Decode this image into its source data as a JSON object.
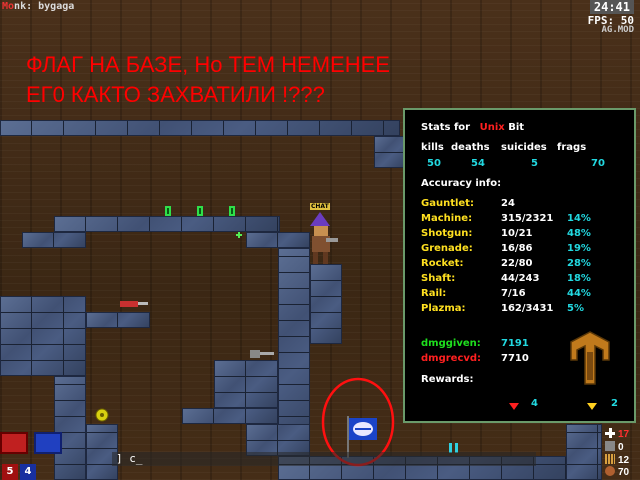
{
  "hud": {
    "player_prefix": "Mo",
    "player_name_rest": "nk",
    "player_separator": ":",
    "player_status": " bygaga",
    "clock": "24:41",
    "fps": "FPS: 50",
    "mod_name": "AG.MOD"
  },
  "chat": {
    "line1": "ФЛАГ НА БАЗЕ, Но ТЕМ НЕМЕНЕЕ",
    "line2": "ЕГ0 КАКТО ЗАХВАТИЛИ !???"
  },
  "stats": {
    "title_prefix": "Stats for",
    "name_red": "Unix",
    "name_white": " Bit",
    "headers": [
      "kills",
      "deaths",
      "suicides",
      "frags"
    ],
    "values": [
      "50",
      "54",
      "5",
      "70"
    ],
    "accuracy_title": "Accuracy info:",
    "weapons": [
      {
        "name": "Gauntlet:",
        "hits": "24",
        "pct": ""
      },
      {
        "name": "Machine:",
        "hits": "315/2321",
        "pct": "14%"
      },
      {
        "name": "Shotgun:",
        "hits": "10/21",
        "pct": "48%"
      },
      {
        "name": "Grenade:",
        "hits": "16/86",
        "pct": "19%"
      },
      {
        "name": "Rocket:",
        "hits": "22/80",
        "pct": "28%"
      },
      {
        "name": "Shaft:",
        "hits": "44/243",
        "pct": "18%"
      },
      {
        "name": "Rail:",
        "hits": "7/16",
        "pct": "44%"
      },
      {
        "name": "Plazma:",
        "hits": "162/3431",
        "pct": "5%"
      }
    ],
    "dmggiven_label": "dmggiven:",
    "dmggiven": "7191",
    "dmgrecvd_label": "dmgrecvd:",
    "dmgrecvd": "7710",
    "rewards_label": "Rewards:",
    "reward_red": "4",
    "reward_yellow": "2"
  },
  "bottom": {
    "score_red": "5",
    "score_blue": "4",
    "console": "] c_",
    "ammo": [
      {
        "value": "17",
        "color": "#ff3030"
      },
      {
        "value": "0",
        "color": "#ffffff"
      },
      {
        "value": "12",
        "color": "#ffffff"
      },
      {
        "value": "70",
        "color": "#ffffff"
      }
    ]
  },
  "world": {
    "player_tag": "CHAT"
  }
}
